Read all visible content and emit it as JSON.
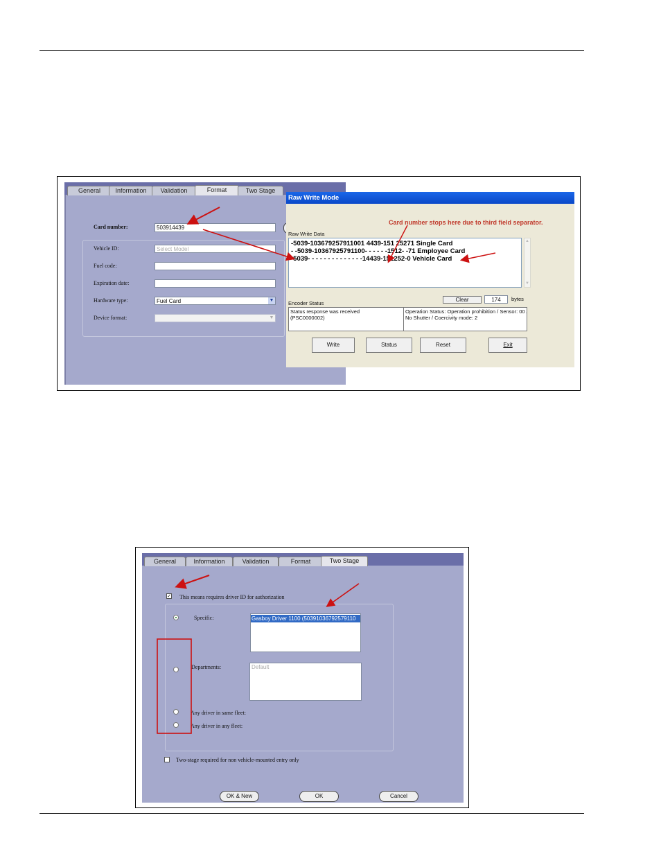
{
  "figure1": {
    "tabs": [
      "General",
      "Information",
      "Validation",
      "Format",
      "Two Stage"
    ],
    "active_tab": "Format",
    "form": {
      "card_number_label": "Card number:",
      "card_number_value": "503914439",
      "vehicle_id_label": "Vehicle ID:",
      "vehicle_id_placeholder": "Select Model",
      "fuel_code_label": "Fuel code:",
      "expiration_label": "Expiration date:",
      "hardware_type_label": "Hardware type:",
      "hardware_type_value": "Fuel Card",
      "device_format_label": "Device format:"
    },
    "raw_write": {
      "title": "Raw Write Mode",
      "annotation": "Card number stops here due to third field separator.",
      "data_label": "Raw Write Data",
      "lines": [
        "-5039-103679257911001 4439-151 25271 Single Card",
        "- -5039-10367925791100- - - - - -1512- -71  Employee Card",
        "-5039- - - - - - - - - - - - - -14439-151252-0 Vehicle Card"
      ],
      "clear_label": "Clear",
      "bytes_value": "174",
      "bytes_label": "bytes",
      "encoder_status_label": "Encoder Status",
      "status_left": [
        "Status response was received",
        "(PSC0000002)"
      ],
      "status_right": [
        "Operation Status: Operation prohibition / Sensor: 00 /",
        "No Shutter / Coercivity mode: 2"
      ],
      "buttons": [
        "Write",
        "Status",
        "Reset",
        "Exit"
      ]
    }
  },
  "figure2": {
    "tabs": [
      "General",
      "Information",
      "Validation",
      "Format",
      "Two Stage"
    ],
    "active_tab": "Two Stage",
    "requires_driver_label": "This means requires driver ID for authorization",
    "specific_label": "Specific:",
    "specific_value": "Gasboy Driver 1100 (50391036792579110",
    "departments_label": "Departments:",
    "departments_value": "Default",
    "any_same_fleet_label": "Any driver in same fleet:",
    "any_fleet_label": "Any driver in any fleet:",
    "two_stage_label": "Two-stage required for non vehicle-mounted entry only",
    "buttons": [
      "OK & New",
      "OK",
      "Cancel"
    ]
  },
  "colors": {
    "panel": "#a5a9cc",
    "tab_bar": "#6a6ea8",
    "title_bar": "#0a50d8",
    "dialog_bg": "#ece9d8",
    "arrow": "#cc1111"
  }
}
